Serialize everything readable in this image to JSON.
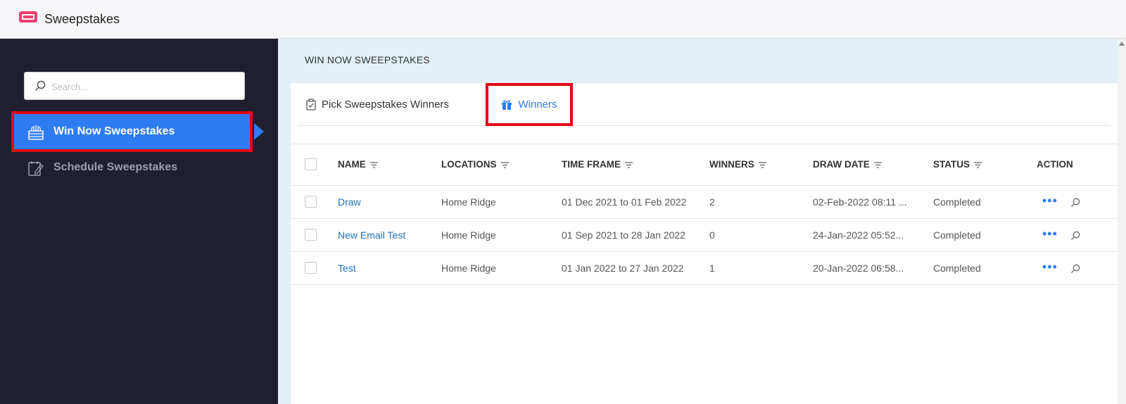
{
  "app": {
    "title": "Sweepstakes",
    "logo_icon": "ticket-icon",
    "accent_color": "#ee3e6e"
  },
  "sidebar": {
    "search_placeholder": "Search...",
    "items": [
      {
        "label": "Win Now Sweepstakes",
        "icon": "gift-basket-icon",
        "active": true
      },
      {
        "label": "Schedule Sweepstakes",
        "icon": "calendar-edit-icon",
        "active": false
      }
    ]
  },
  "main": {
    "section_title": "WIN NOW SWEEPSTAKES",
    "tabs": [
      {
        "label": "Pick Sweepstakes Winners",
        "icon": "clipboard-check-icon",
        "active": false
      },
      {
        "label": "Winners",
        "icon": "gift-icon",
        "active": true
      }
    ],
    "table": {
      "columns": [
        "NAME",
        "LOCATIONS",
        "TIME FRAME",
        "WINNERS",
        "DRAW DATE",
        "STATUS",
        "ACTION"
      ],
      "rows": [
        {
          "name": "Draw",
          "location": "Home Ridge",
          "time_frame": "01 Dec 2021 to 01 Feb 2022",
          "winners": "2",
          "draw_date": "02-Feb-2022 08:11 ...",
          "status": "Completed"
        },
        {
          "name": "New Email Test",
          "location": "Home Ridge",
          "time_frame": "01 Sep 2021 to 28 Jan 2022",
          "winners": "0",
          "draw_date": "24-Jan-2022 05:52...",
          "status": "Completed"
        },
        {
          "name": "Test",
          "location": "Home Ridge",
          "time_frame": "01 Jan 2022 to 27 Jan 2022",
          "winners": "1",
          "draw_date": "20-Jan-2022 06:58...",
          "status": "Completed"
        }
      ]
    }
  },
  "colors": {
    "sidebar_bg": "#1f1f2e",
    "active_nav": "#2f7cf2",
    "highlight": "#e30613",
    "link": "#1f6fb5"
  }
}
